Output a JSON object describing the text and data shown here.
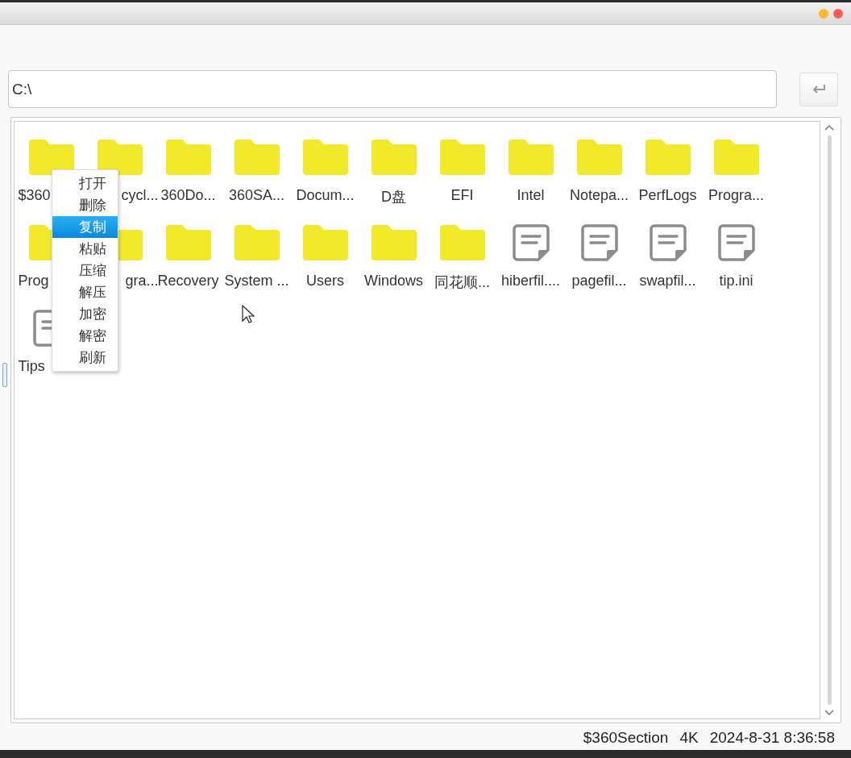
{
  "path_field": {
    "value": "C:\\"
  },
  "items": [
    {
      "kind": "folder",
      "label": "$360",
      "covered_end": true
    },
    {
      "kind": "folder",
      "label": "cycl...",
      "covered_start": true
    },
    {
      "kind": "folder",
      "label": "360Do..."
    },
    {
      "kind": "folder",
      "label": "360SA..."
    },
    {
      "kind": "folder",
      "label": "Docum..."
    },
    {
      "kind": "folder",
      "label": "D盘"
    },
    {
      "kind": "folder",
      "label": "EFI"
    },
    {
      "kind": "folder",
      "label": "Intel"
    },
    {
      "kind": "folder",
      "label": "Notepa..."
    },
    {
      "kind": "folder",
      "label": "PerfLogs"
    },
    {
      "kind": "folder",
      "label": "Progra..."
    },
    {
      "kind": "folder",
      "label": "Prog",
      "covered_end": true
    },
    {
      "kind": "folder",
      "label": "gra...",
      "covered_start": true
    },
    {
      "kind": "folder",
      "label": "Recovery"
    },
    {
      "kind": "folder",
      "label": "System ..."
    },
    {
      "kind": "folder",
      "label": "Users"
    },
    {
      "kind": "folder",
      "label": "Windows"
    },
    {
      "kind": "folder",
      "label": "同花顺..."
    },
    {
      "kind": "file",
      "label": "hiberfil...."
    },
    {
      "kind": "file",
      "label": "pagefil..."
    },
    {
      "kind": "file",
      "label": "swapfil..."
    },
    {
      "kind": "file",
      "label": "tip.ini"
    },
    {
      "kind": "file",
      "label": "Tips",
      "covered_end": true
    }
  ],
  "context_menu": [
    {
      "label": "打开",
      "selected": false
    },
    {
      "label": "删除",
      "selected": false
    },
    {
      "label": "复制",
      "selected": true
    },
    {
      "label": "粘贴",
      "selected": false
    },
    {
      "label": "压缩",
      "selected": false
    },
    {
      "label": "解压",
      "selected": false
    },
    {
      "label": "加密",
      "selected": false
    },
    {
      "label": "解密",
      "selected": false
    },
    {
      "label": "刷新",
      "selected": false
    }
  ],
  "status_bar": {
    "name": "$360Section",
    "size": "4K",
    "modified": "2024-8-31 8:36:58"
  }
}
